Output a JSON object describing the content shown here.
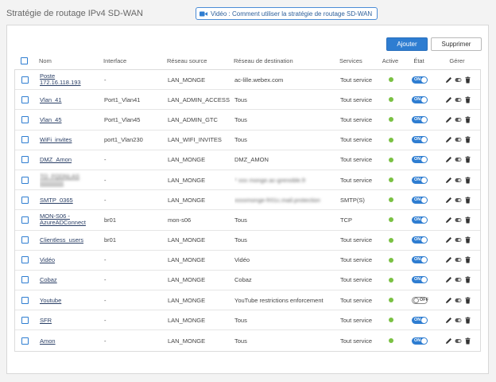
{
  "header": {
    "title": "Stratégie de routage IPv4 SD-WAN",
    "video_link": "Vidéo : Comment utiliser la stratégie de routage SD-WAN"
  },
  "toolbar": {
    "add_label": "Ajouter",
    "delete_label": "Supprimer"
  },
  "columns": {
    "name": "Nom",
    "interface": "Interface",
    "source": "Réseau source",
    "destination": "Réseau de destination",
    "services": "Services",
    "active": "Active",
    "state": "État",
    "manage": "Gérer"
  },
  "rows": [
    {
      "name_line1": "Poste",
      "name_line2": "172.16.118.193",
      "interface": "-",
      "source": "LAN_MONGE",
      "destination": "ac-lille.webex.com",
      "services": "Tout service",
      "enabled": true,
      "state": "ON"
    },
    {
      "name": "Vlan_41",
      "interface": "Port1_Vlan41",
      "source": "LAN_ADMIN_ACCESS",
      "destination": "Tous",
      "services": "Tout service",
      "enabled": true,
      "state": "ON"
    },
    {
      "name": "Vlan_45",
      "interface": "Port1_Vlan45",
      "source": "LAN_ADMIN_GTC",
      "destination": "Tous",
      "services": "Tout service",
      "enabled": true,
      "state": "ON"
    },
    {
      "name": "WiFi_invites",
      "interface": "port1_Vlan230",
      "source": "LAN_WIFI_INVITES",
      "destination": "Tous",
      "services": "Tout service",
      "enabled": true,
      "state": "ON"
    },
    {
      "name": "DMZ_Amon",
      "interface": "-",
      "source": "LAN_MONGE",
      "destination": "DMZ_AMON",
      "services": "Tout service",
      "enabled": true,
      "state": "ON"
    },
    {
      "blur_name_line1": "TO_FQDNLAS",
      "blur_name_line2": "xxxxxxxx",
      "interface": "-",
      "source": "LAN_MONGE",
      "blur_destination": "* xxx monge.ac-grenoble.fr",
      "services": "Tout service",
      "enabled": true,
      "state": "ON"
    },
    {
      "name": "SMTP_0365",
      "interface": "-",
      "source": "LAN_MONGE",
      "blur_destination": "xxxxmonge-fr01c.mail.protection",
      "services": "SMTP(S)",
      "enabled": true,
      "state": "ON"
    },
    {
      "name_line1": "MON-S06 -",
      "name_line2": "AzureADConnect",
      "interface": "br01",
      "source": "mon-s06",
      "destination": "Tous",
      "services": "TCP",
      "enabled": true,
      "state": "ON"
    },
    {
      "name": "Clientless_users",
      "interface": "br01",
      "source": "LAN_MONGE",
      "destination": "Tous",
      "services": "Tout service",
      "enabled": true,
      "state": "ON"
    },
    {
      "name": "Vidéo",
      "interface": "-",
      "source": "LAN_MONGE",
      "destination": "Vidéo",
      "services": "Tout service",
      "enabled": true,
      "state": "ON"
    },
    {
      "name": "Cobaz",
      "interface": "-",
      "source": "LAN_MONGE",
      "destination": "Cobaz",
      "services": "Tout service",
      "enabled": true,
      "state": "ON"
    },
    {
      "name": "Youtube",
      "interface": "-",
      "source": "LAN_MONGE",
      "destination": "YouTube restrictions enforcement",
      "services": "Tout service",
      "enabled": false,
      "state": "OFF"
    },
    {
      "name": "SFR",
      "interface": "-",
      "source": "LAN_MONGE",
      "destination": "Tous",
      "services": "Tout service",
      "enabled": true,
      "state": "ON"
    },
    {
      "name": "Amon",
      "interface": "-",
      "source": "LAN_MONGE",
      "destination": "Tous",
      "services": "Tout service",
      "enabled": true,
      "state": "ON"
    }
  ],
  "icons": {
    "video": "video-camera-icon",
    "edit": "pencil-icon",
    "toggle": "toggle-icon",
    "delete": "trash-icon"
  },
  "colors": {
    "accent": "#2e7dd1",
    "active_dot": "#7ac143"
  }
}
